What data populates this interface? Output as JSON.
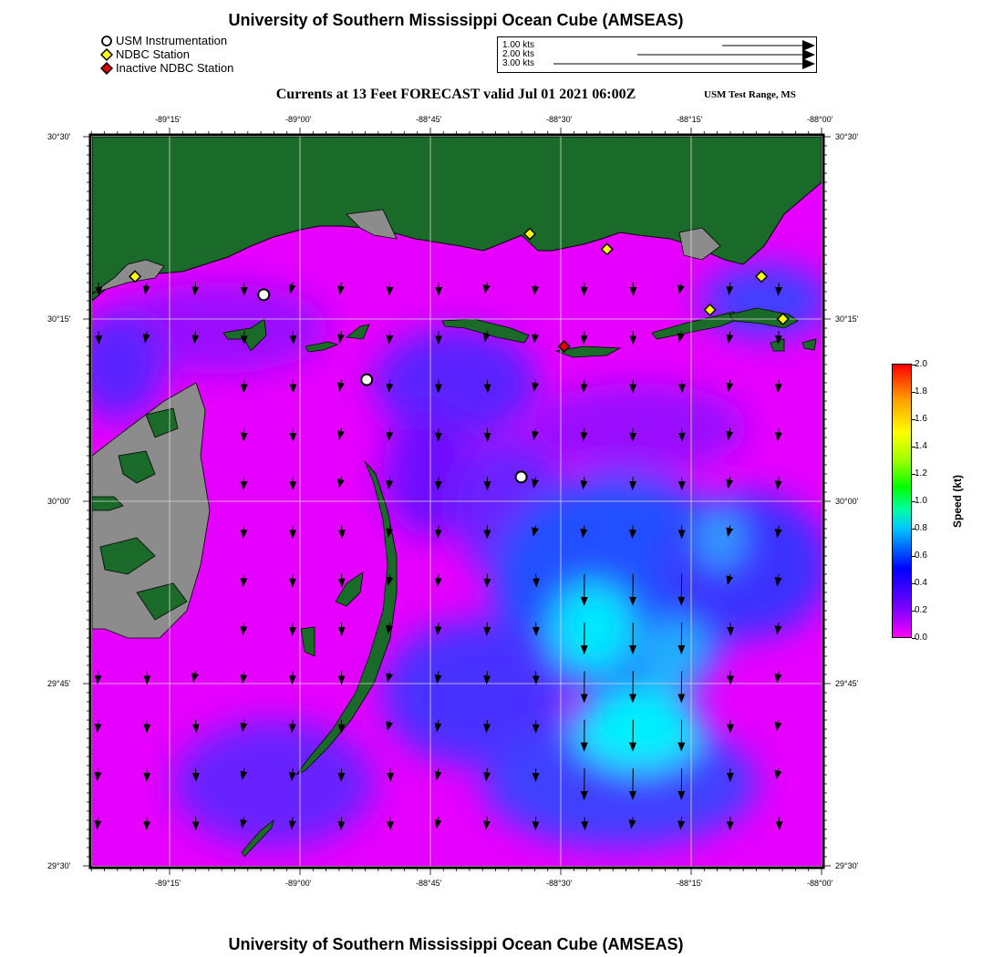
{
  "header": {
    "title": "University of Southern Mississippi Ocean Cube (AMSEAS)",
    "subtitle": "Currents at 13 Feet FORECAST valid Jul 01 2021 06:00Z",
    "region": "USM Test Range, MS"
  },
  "footer": {
    "title": "University of Southern Mississippi Ocean Cube (AMSEAS)"
  },
  "legend": {
    "items": [
      {
        "label": "USM Instrumentation",
        "color": "#ffffff",
        "shape": "circle"
      },
      {
        "label": "NDBC Station",
        "color": "#ffff00",
        "shape": "diamond"
      },
      {
        "label": "Inactive NDBC Station",
        "color": "#dd0000",
        "shape": "diamond"
      }
    ]
  },
  "scale": [
    {
      "label": "1.00 kts",
      "knots": 1.0
    },
    {
      "label": "2.00 kts",
      "knots": 2.0
    },
    {
      "label": "3.00 kts",
      "knots": 3.0
    }
  ],
  "map": {
    "lon_ticks": [
      "-89°15'",
      "-89°00'",
      "-88°45'",
      "-88°30'",
      "-88°15'",
      "-88°00'"
    ],
    "lat_ticks": [
      "30°30'",
      "30°15'",
      "30°00'",
      "29°45'",
      "29°30'"
    ],
    "lon_range": [
      -89.4167,
      -88.0
    ],
    "lat_range": [
      29.5,
      30.5
    ],
    "colors": {
      "land": "#1a6b29",
      "marsh": "#8c8c8c",
      "slow_water": "#ff00ff",
      "fast_water": "#00ffff"
    }
  },
  "colorbar": {
    "label": "Speed (kt)",
    "ticks": [
      "2.0",
      "1.8",
      "1.6",
      "1.4",
      "1.2",
      "1.0",
      "0.8",
      "0.6",
      "0.4",
      "0.2",
      "0.0"
    ],
    "range": [
      0.0,
      2.0
    ]
  },
  "usm_instruments": [
    {
      "lon": -89.0833,
      "lat": 30.2833
    },
    {
      "lon": -88.8833,
      "lat": 30.1667
    },
    {
      "lon": -88.5833,
      "lat": 30.0333
    }
  ],
  "ndbc_stations": [
    {
      "lon": -89.3333,
      "lat": 30.3083
    },
    {
      "lon": -88.5667,
      "lat": 30.3667
    },
    {
      "lon": -88.4167,
      "lat": 30.3458
    },
    {
      "lon": -88.2167,
      "lat": 30.2625
    },
    {
      "lon": -88.1167,
      "lat": 30.3083
    },
    {
      "lon": -88.075,
      "lat": 30.25
    }
  ],
  "inactive_ndbc_stations": [
    {
      "lon": -88.5,
      "lat": 30.2125
    }
  ]
}
